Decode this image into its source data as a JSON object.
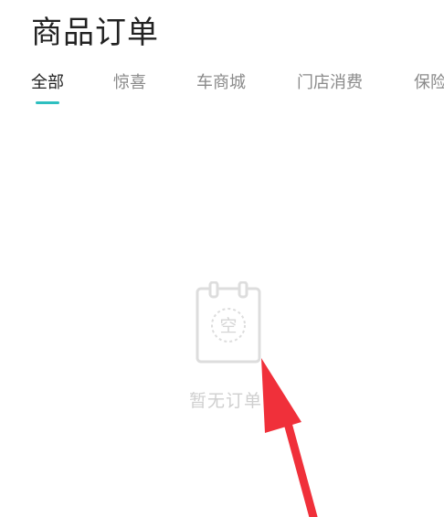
{
  "header": {
    "title": "商品订单"
  },
  "tabs": [
    {
      "label": "全部",
      "active": true
    },
    {
      "label": "惊喜"
    },
    {
      "label": "车商城"
    },
    {
      "label": "门店消费"
    },
    {
      "label": "保险"
    }
  ],
  "empty_state": {
    "icon_glyph": "空",
    "text": "暂无订单"
  },
  "colors": {
    "accent": "#2ebfc0",
    "annotation_arrow": "#f0303a"
  }
}
